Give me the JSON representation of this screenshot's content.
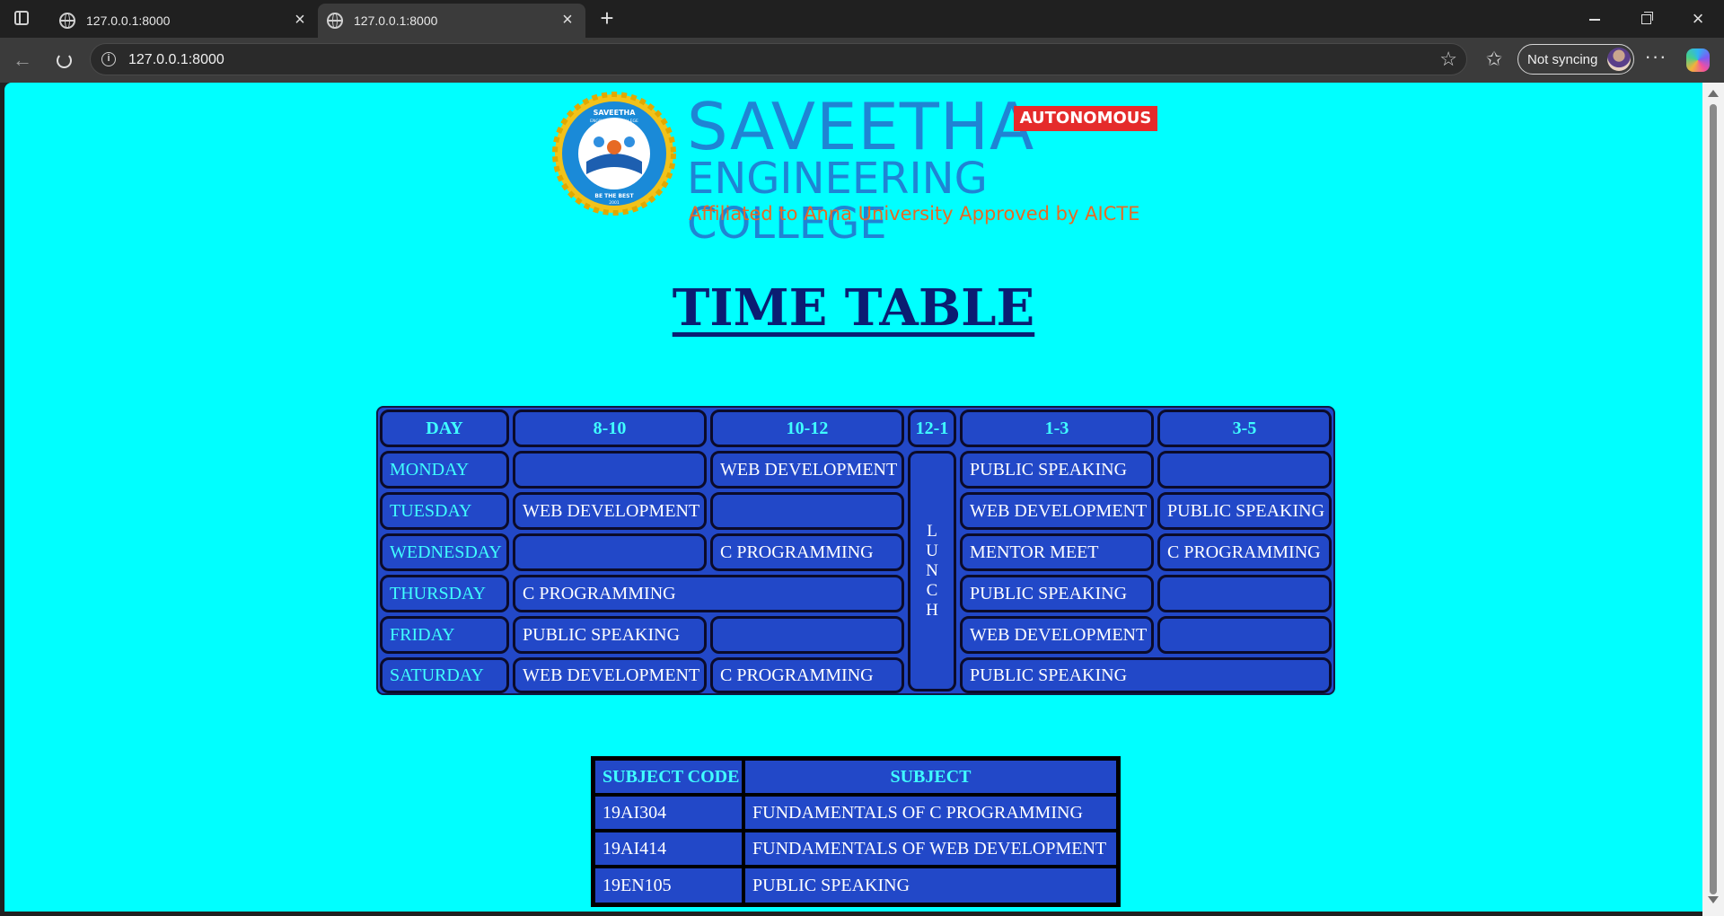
{
  "browser": {
    "tabs": [
      {
        "title": "127.0.0.1:8000",
        "active": false
      },
      {
        "title": "127.0.0.1:8000",
        "active": true
      }
    ],
    "url": "127.0.0.1:8000",
    "sync_label": "Not syncing",
    "icons": [
      "tab-actions-icon",
      "globe-icon",
      "close-icon",
      "new-tab-icon",
      "minimize-icon",
      "maximize-icon",
      "window-close-icon",
      "back-icon",
      "reload-icon",
      "info-icon",
      "star-icon",
      "favorites-icon",
      "more-icon",
      "copilot-icon"
    ]
  },
  "logo": {
    "name": "SAVEETHA",
    "sub": "ENGINEERING COLLEGE",
    "tagline": "Affiliated to Anna University  Approved by AICTE",
    "badge": "AUTONOMOUS",
    "seal_text_top": "SAVEETHA",
    "seal_text_mid": "ENGINEERING COLLEGE",
    "seal_text_bottom": "BE THE BEST",
    "seal_year": "2001"
  },
  "page": {
    "title": "TIME TABLE"
  },
  "timetable": {
    "headers": [
      "DAY",
      "8-10",
      "10-12",
      "12-1",
      "1-3",
      "3-5"
    ],
    "lunch": [
      "L",
      "U",
      "N",
      "C",
      "H"
    ],
    "rows": [
      {
        "day": "MONDAY",
        "s1": "",
        "s2": "WEB DEVELOPMENT",
        "s4": "PUBLIC SPEAKING",
        "s5": ""
      },
      {
        "day": "TUESDAY",
        "s1": "WEB DEVELOPMENT",
        "s2": "",
        "s4": "WEB DEVELOPMENT",
        "s5": "PUBLIC SPEAKING"
      },
      {
        "day": "WEDNESDAY",
        "s1": "",
        "s2": "C PROGRAMMING",
        "s4": "MENTOR MEET",
        "s5": "C PROGRAMMING"
      },
      {
        "day": "THURSDAY",
        "s12": "C PROGRAMMING",
        "s4": "PUBLIC SPEAKING",
        "s5": ""
      },
      {
        "day": "FRIDAY",
        "s1": "PUBLIC SPEAKING",
        "s2": "",
        "s4": "WEB DEVELOPMENT",
        "s5": ""
      },
      {
        "day": "SATURDAY",
        "s1": "WEB DEVELOPMENT",
        "s2": "C PROGRAMMING",
        "s45": "PUBLIC SPEAKING"
      }
    ]
  },
  "subjects": {
    "headers": [
      "SUBJECT CODE",
      "SUBJECT"
    ],
    "rows": [
      {
        "code": "19AI304",
        "name": "FUNDAMENTALS OF C PROGRAMMING"
      },
      {
        "code": "19AI414",
        "name": "FUNDAMENTALS OF WEB DEVELOPMENT"
      },
      {
        "code": "19EN105",
        "name": "PUBLIC SPEAKING"
      }
    ]
  },
  "colors": {
    "page_bg": "#00ffff",
    "table_bg": "#2248c8",
    "header_text": "#40ffff",
    "title": "#0b1d72",
    "college_blue": "#1f84d4",
    "college_orange": "#e76a24",
    "badge_red": "#e52b2b"
  }
}
